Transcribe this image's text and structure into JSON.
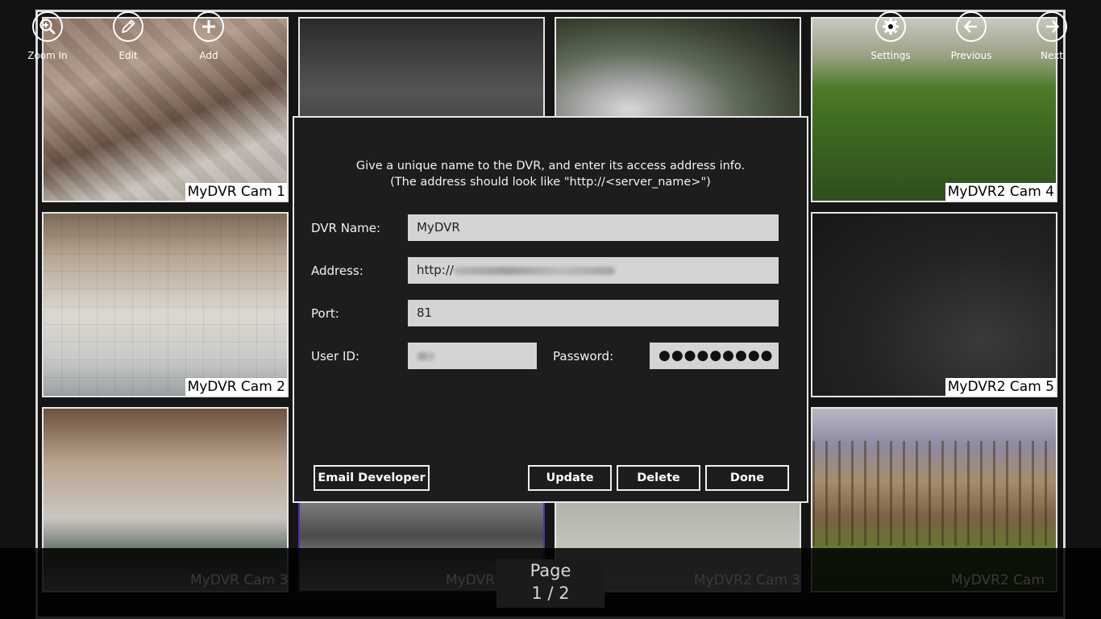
{
  "cameras": [
    {
      "label": "MyDVR Cam 1"
    },
    {
      "label": "MyDVR Cam 2"
    },
    {
      "label": "MyDVR2 Cam 4"
    },
    {
      "label": "MyDVR2 Cam 5"
    }
  ],
  "ghost_labels": [
    "MyDVR Cam 3",
    "MyDVR Cam",
    "MyDVR2 Cam 3",
    "MyDVR2 Cam"
  ],
  "dialog": {
    "message_line1": "Give a unique name to the DVR, and enter its access address info.",
    "message_line2": "(The address should look like \"http://<server_name>\")",
    "dvr_name_label": "DVR Name:",
    "dvr_name_value": "MyDVR",
    "address_label": "Address:",
    "address_value": "http://",
    "port_label": "Port:",
    "port_value": "81",
    "userid_label": "User ID:",
    "password_label": "Password:",
    "password_value": "●●●●●●●●●",
    "buttons": {
      "email_developer": "Email Developer",
      "update": "Update",
      "delete": "Delete",
      "done": "Done"
    }
  },
  "app_bar": {
    "zoom_in": "Zoom In",
    "edit": "Edit",
    "add": "Add",
    "settings": "Settings",
    "previous": "Previous",
    "next": "Next",
    "page_title": "Page",
    "page_number": "1 / 2"
  }
}
